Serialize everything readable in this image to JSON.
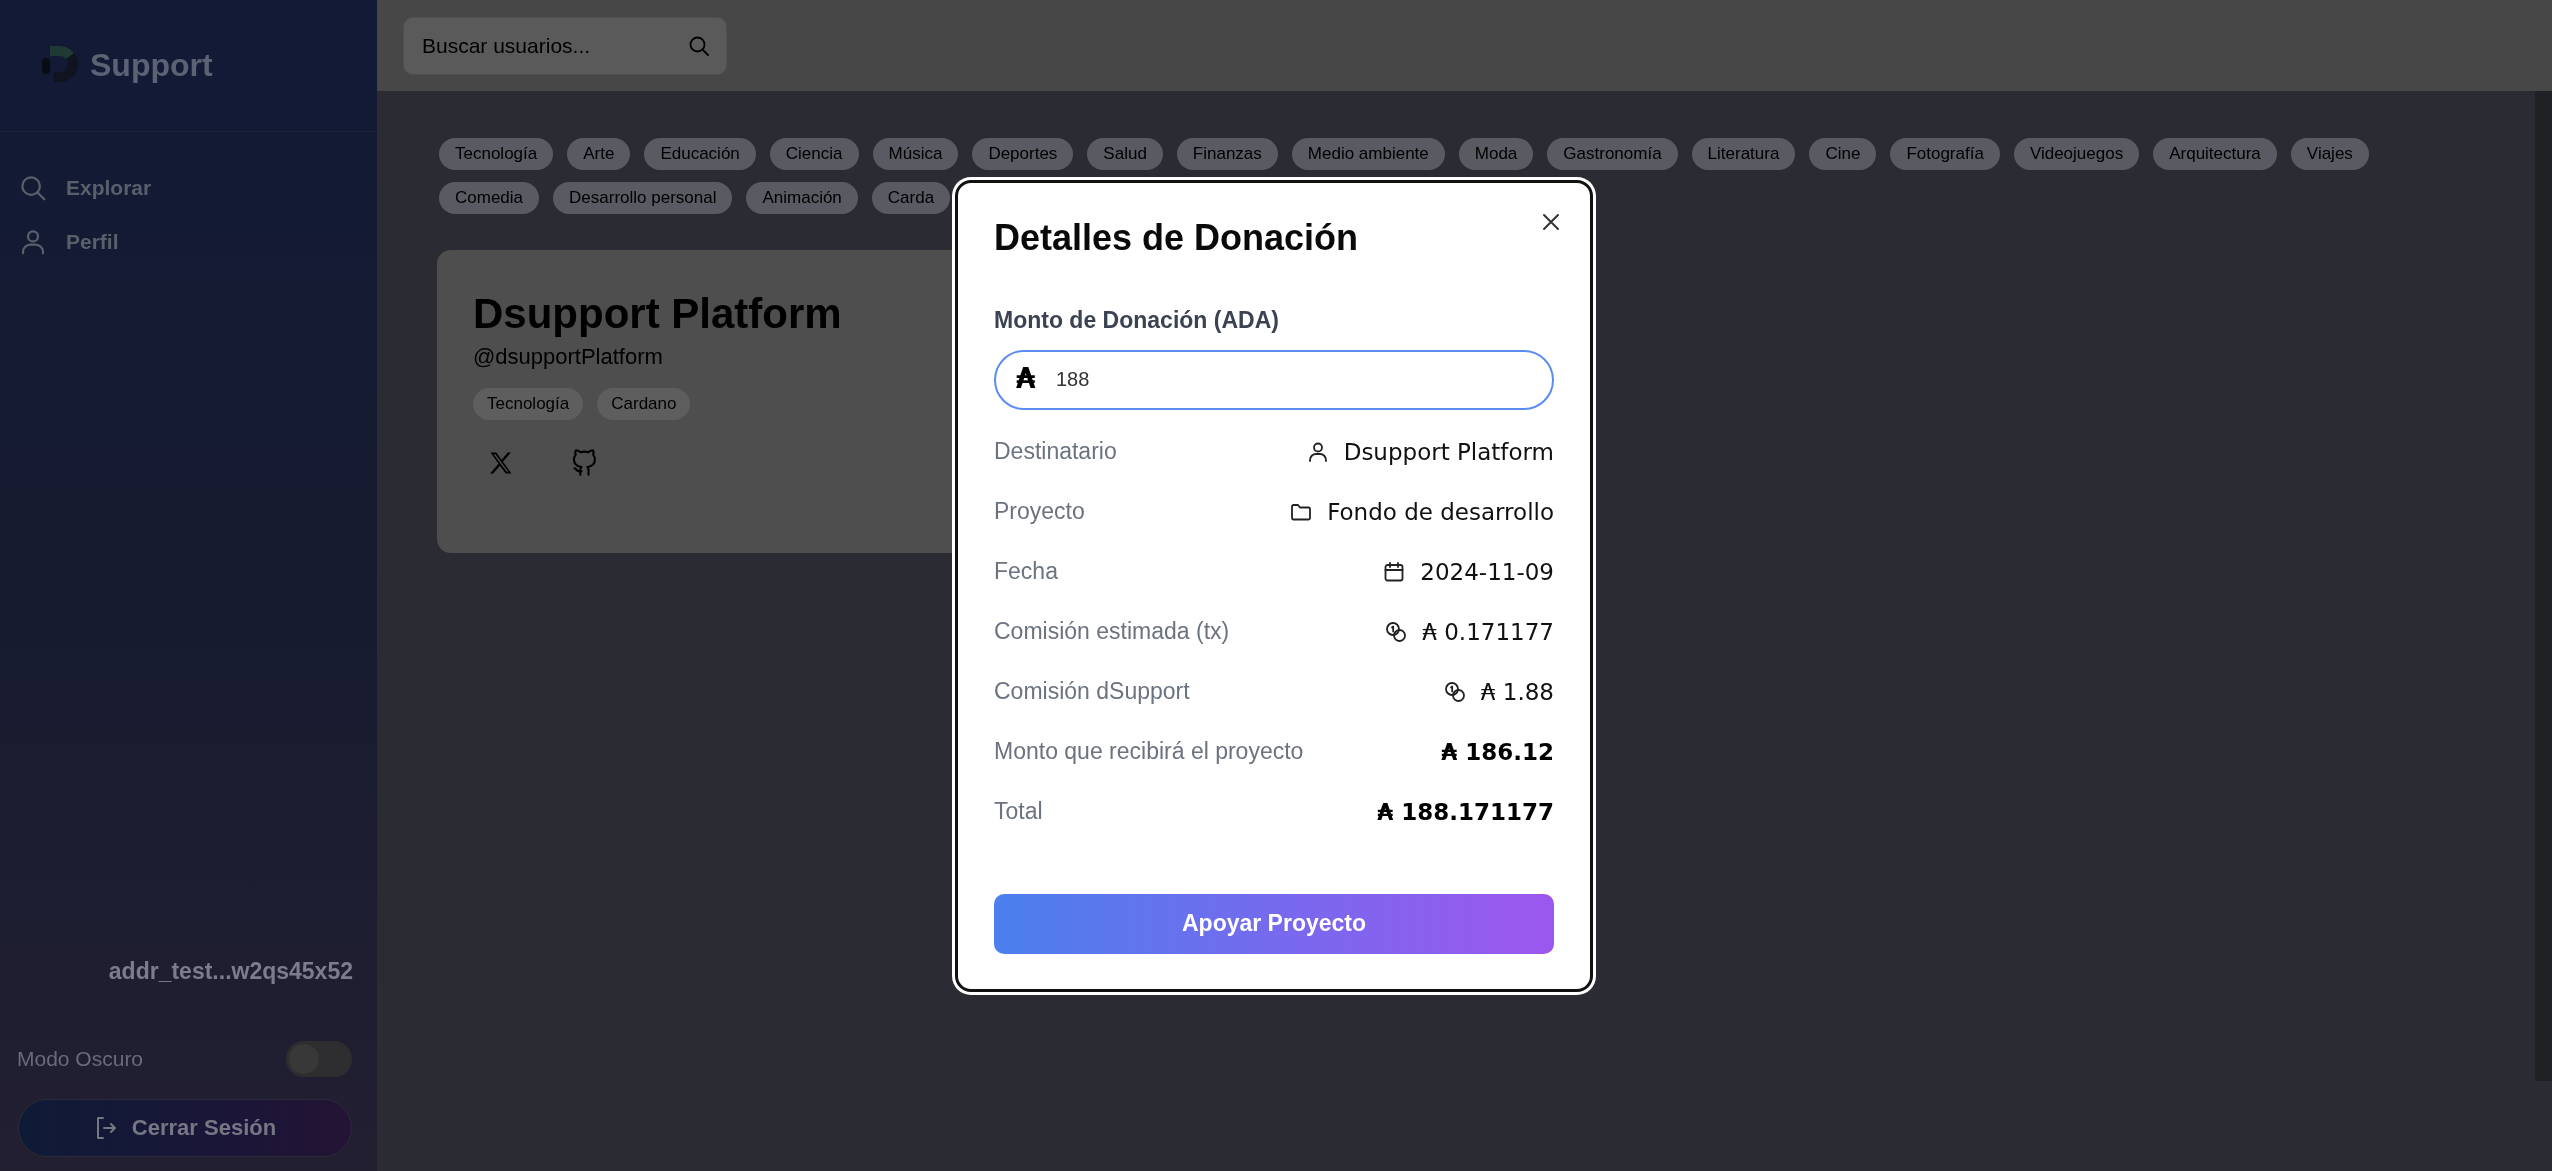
{
  "sidebar": {
    "logo_text": "Support",
    "nav": [
      {
        "label": "Explorar",
        "selected": false
      },
      {
        "label": "Perfil",
        "selected": false
      }
    ],
    "wallet_address": "addr_test...w2qs45x52",
    "dark_mode": {
      "label": "Modo Oscuro",
      "on": false
    },
    "logout_button": "Cerrar Sesión"
  },
  "search": {
    "placeholder": "Buscar usuarios..."
  },
  "category_rows": [
    [
      "Tecnología",
      "Arte",
      "Educación",
      "Ciencia",
      "Música",
      "Deportes",
      "Salud",
      "Finanzas",
      "Medio ambiente",
      "Moda",
      "Gastronomía",
      "Literatura",
      "Cine",
      "Fotografía",
      "Videojuegos",
      "Arquitectura",
      "Viajes"
    ],
    [
      "Comedia",
      "Desarrollo personal",
      "Animación",
      "Carda"
    ]
  ],
  "profile_card": {
    "name": "Dsupport Platform",
    "handle": "@dsupportPlatform",
    "tags": [
      "Tecnología",
      "Cardano"
    ]
  },
  "donation_modal": {
    "title": "Detalles de Donación",
    "amount_label": "Monto de Donación (ADA)",
    "currency_symbol": "₳",
    "amount_value": "188",
    "details": [
      {
        "label": "Destinatario",
        "value": "Dsupport Platform",
        "emphasis": false
      },
      {
        "label": "Proyecto",
        "value": "Fondo de desarrollo",
        "emphasis": false
      },
      {
        "label": "Fecha",
        "value": "2024-11-09",
        "emphasis": false
      },
      {
        "label": "Comisión estimada (tx)",
        "value": "₳ 0.171177",
        "emphasis": false
      },
      {
        "label": "Comisión dSupport",
        "value": "₳ 1.88",
        "emphasis": false
      },
      {
        "label": "Monto que recibirá el proyecto",
        "value": "₳ 186.12",
        "emphasis": true
      },
      {
        "label": "Total",
        "value": "₳ 188.171177",
        "emphasis": true
      }
    ],
    "submit_button": "Apoyar Proyecto"
  }
}
